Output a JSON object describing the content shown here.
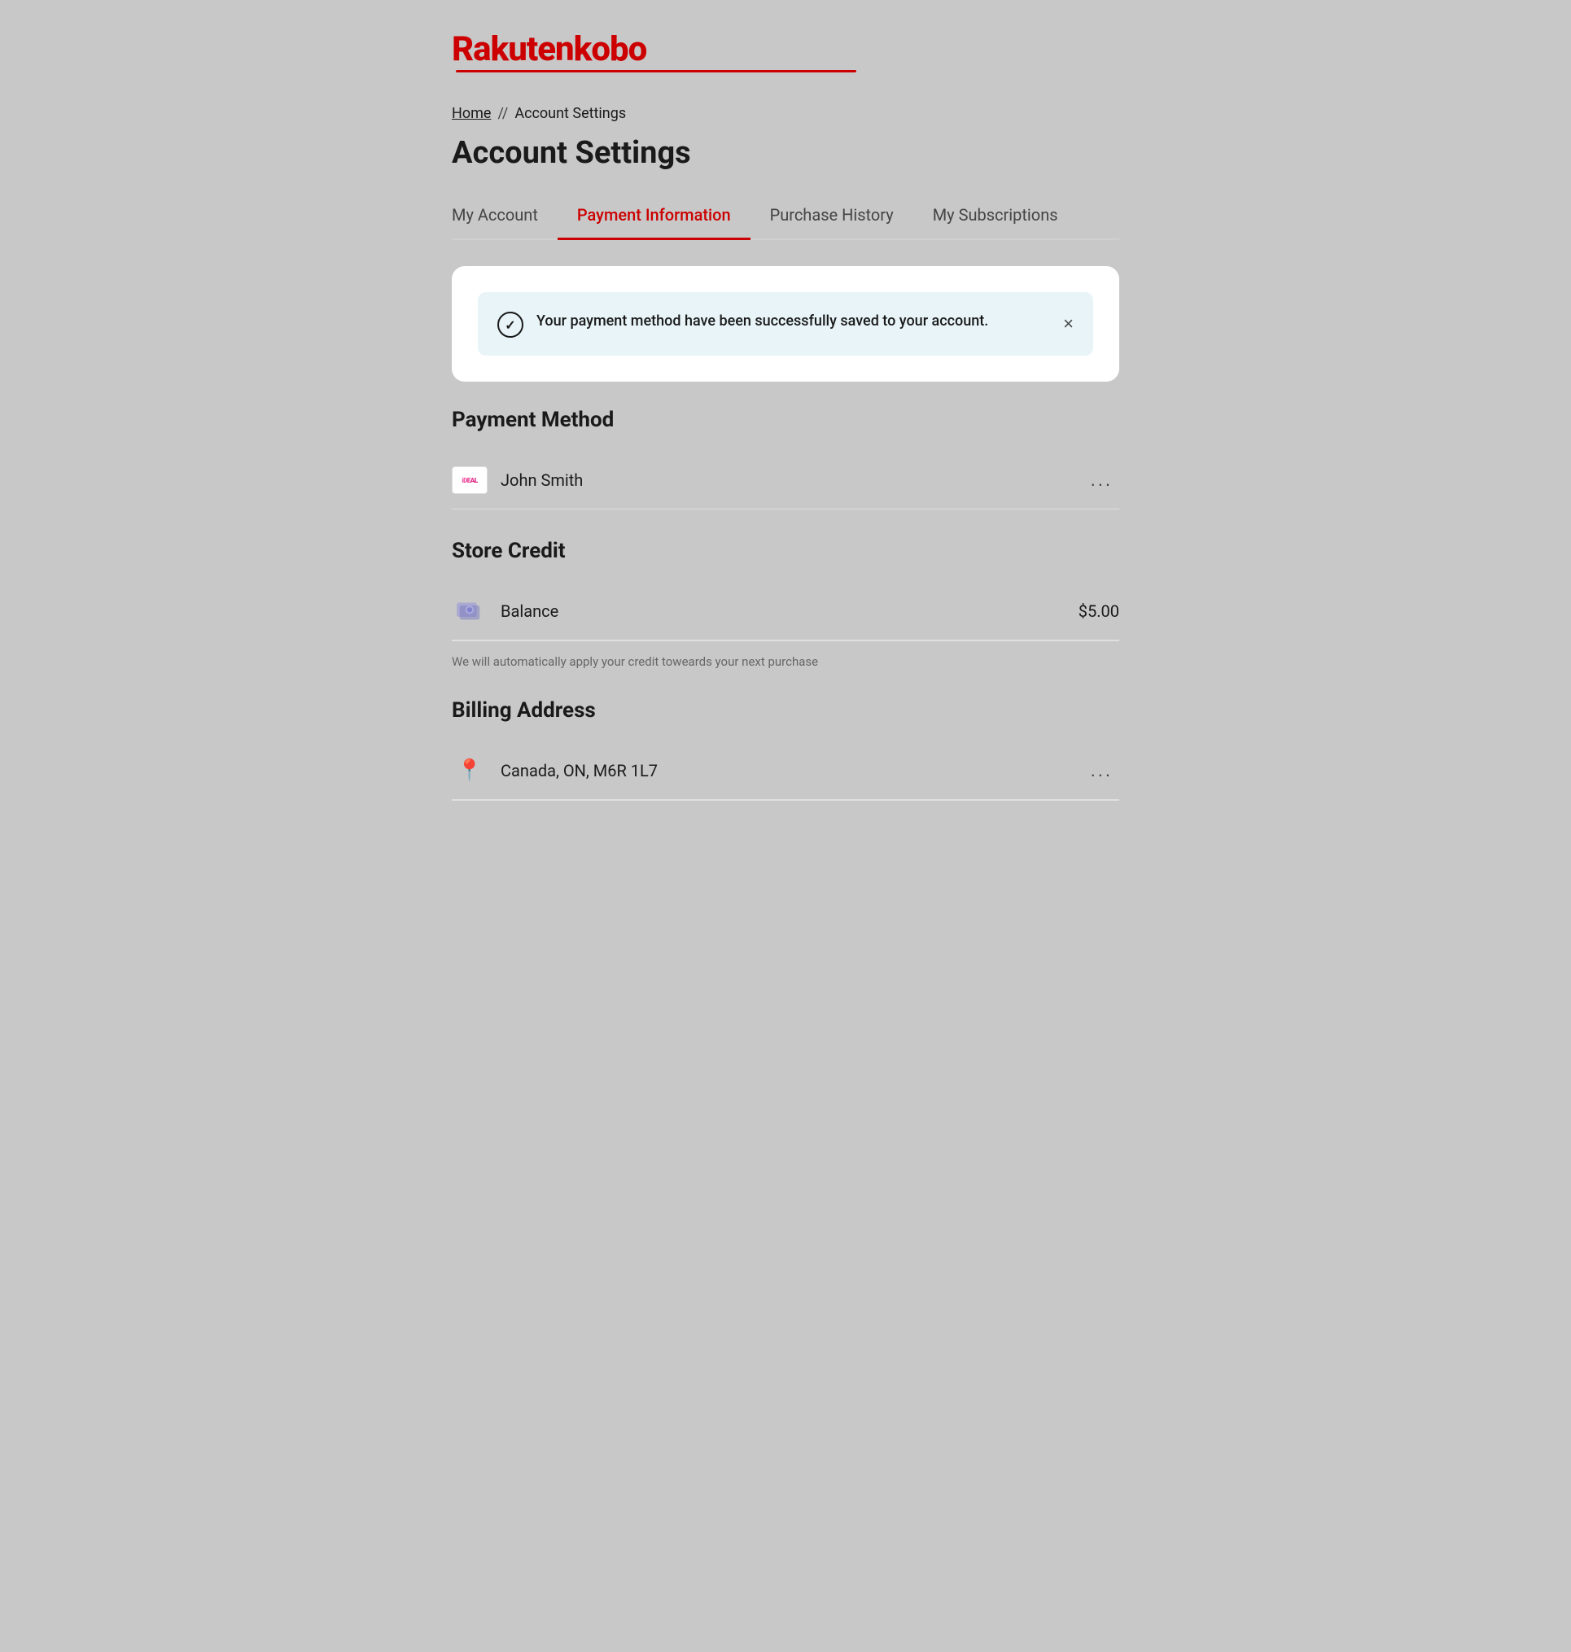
{
  "logo": {
    "text": "Rakuten kobo",
    "rakuten": "Rakuten",
    "kobo": "kobo"
  },
  "breadcrumb": {
    "home": "Home",
    "separator": "//",
    "current": "Account Settings"
  },
  "page_title": "Account Settings",
  "tabs": [
    {
      "id": "my-account",
      "label": "My Account",
      "active": false
    },
    {
      "id": "payment-information",
      "label": "Payment Information",
      "active": true
    },
    {
      "id": "purchase-history",
      "label": "Purchase History",
      "active": false
    },
    {
      "id": "my-subscriptions",
      "label": "My Subscriptions",
      "active": false
    }
  ],
  "success_banner": {
    "message": "Your payment method have been successfully saved to your account.",
    "close_label": "×"
  },
  "payment_method": {
    "section_title": "Payment Method",
    "items": [
      {
        "icon": "ideal",
        "name": "John Smith",
        "more": "..."
      }
    ]
  },
  "store_credit": {
    "section_title": "Store Credit",
    "balance_label": "Balance",
    "balance_amount": "$5.00",
    "note": "We will automatically apply your credit toweards your next purchase"
  },
  "billing_address": {
    "section_title": "Billing Address",
    "items": [
      {
        "address": "Canada, ON, M6R 1L7",
        "more": "..."
      }
    ]
  }
}
